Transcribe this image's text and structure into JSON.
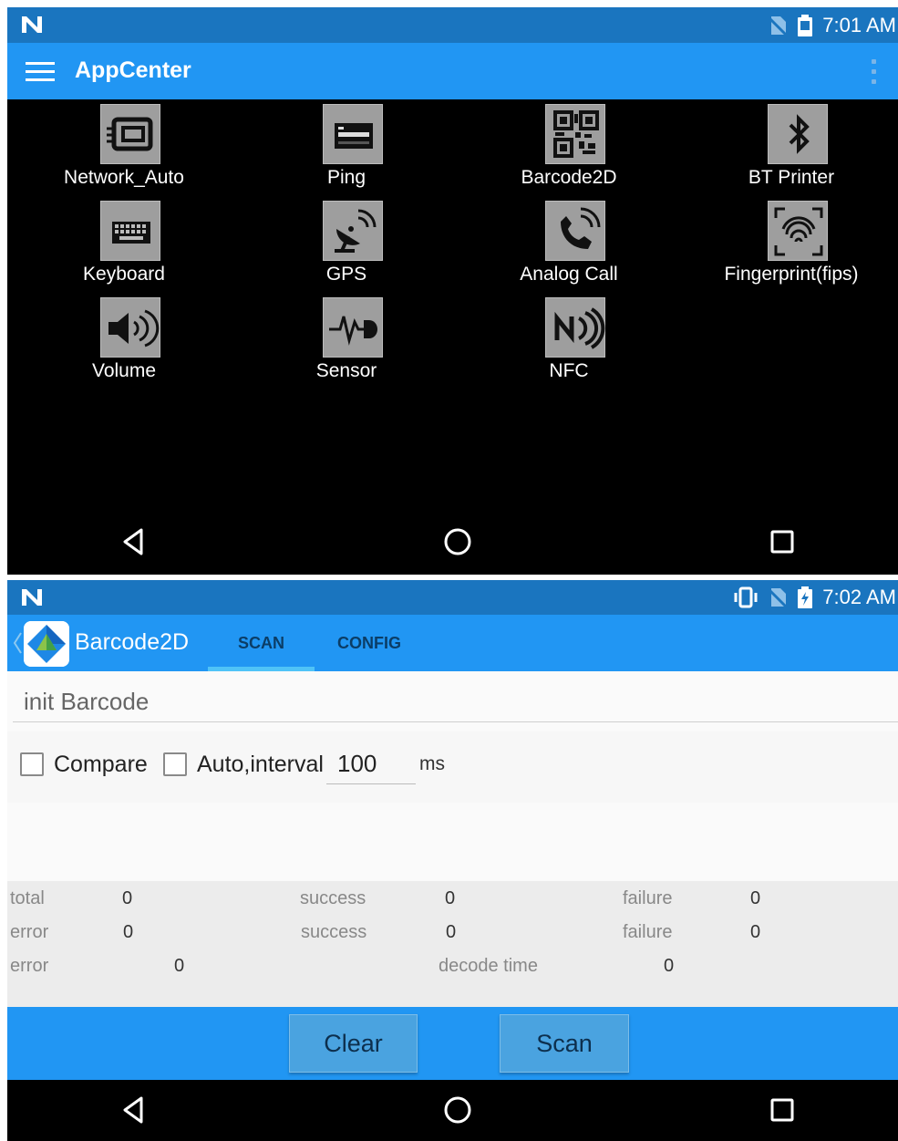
{
  "screen1": {
    "status": {
      "time": "7:01 AM"
    },
    "app_title": "AppCenter",
    "apps": [
      {
        "label": "Network_Auto",
        "icon": "network-card-icon"
      },
      {
        "label": "Ping",
        "icon": "server-icon"
      },
      {
        "label": "Barcode2D",
        "icon": "qr-code-icon"
      },
      {
        "label": "BT Printer",
        "icon": "bluetooth-icon"
      },
      {
        "label": "Keyboard",
        "icon": "keyboard-icon"
      },
      {
        "label": "GPS",
        "icon": "satellite-dish-icon"
      },
      {
        "label": "Analog Call",
        "icon": "phone-ringing-icon"
      },
      {
        "label": "Fingerprint(fips)",
        "icon": "fingerprint-icon"
      },
      {
        "label": "Volume",
        "icon": "speaker-icon"
      },
      {
        "label": "Sensor",
        "icon": "heartbeat-sensor-icon"
      },
      {
        "label": "NFC",
        "icon": "nfc-icon"
      }
    ]
  },
  "screen2": {
    "status": {
      "time": "7:02 AM"
    },
    "app_name": "Barcode2D",
    "tabs": [
      {
        "label": "SCAN",
        "selected": true
      },
      {
        "label": "CONFIG",
        "selected": false
      }
    ],
    "init_text": "init Barcode",
    "options": {
      "compare_label": "Compare",
      "compare_checked": false,
      "auto_label": "Auto,interval",
      "auto_checked": false,
      "interval_value": "100",
      "unit": "ms"
    },
    "stats": {
      "row1": {
        "total_label": "total",
        "total_value": "0",
        "success_label": "success",
        "success_value": "0",
        "failure_label": "failure",
        "failure_value": "0"
      },
      "row2": {
        "error_label": "error",
        "error_value": "0",
        "success_label": "success",
        "success_value": "0",
        "failure_label": "failure",
        "failure_value": "0"
      },
      "row3": {
        "error_label": "error",
        "error_value": "0",
        "decode_label": "decode time",
        "decode_value": "0"
      }
    },
    "buttons": {
      "clear": "Clear",
      "scan": "Scan"
    }
  },
  "colors": {
    "status_bar": "#1a75bf",
    "app_bar": "#2196f3",
    "tab_indicator": "#4fc3f7",
    "icon_tile": "#9e9e9e",
    "background_dark": "#000000"
  }
}
